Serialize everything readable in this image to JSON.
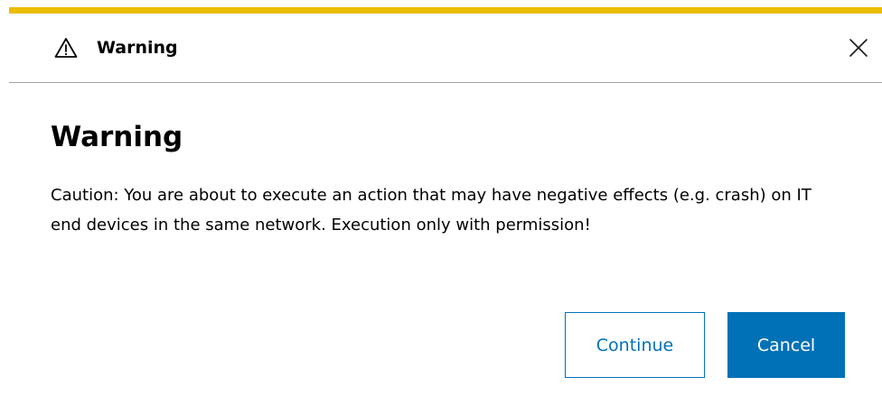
{
  "dialog": {
    "header_title": "Warning",
    "heading": "Warning",
    "message": "Caution: You are about to execute an action that may have negative effects (e.g. crash) on IT end devices in the same network. Execution only with permission!",
    "continue_label": "Continue",
    "cancel_label": "Cancel"
  },
  "icons": {
    "header": "warning-triangle-icon",
    "close": "close-icon"
  },
  "colors": {
    "accent": "#ecbc00",
    "primary": "#0071b7",
    "divider": "#a3a3a3",
    "text": "#000000"
  }
}
